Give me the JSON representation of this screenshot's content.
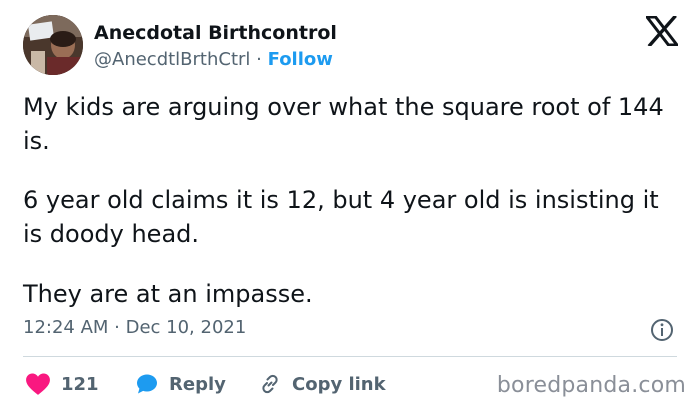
{
  "author": {
    "name": "Anecdotal Birthcontrol",
    "handle": "@AnecdtlBrthCtrl",
    "separator": "·",
    "follow_label": "Follow",
    "avatar_icon": "profile-photo"
  },
  "platform": {
    "logo_icon": "x-logo"
  },
  "tweet": {
    "paragraphs": [
      "My kids are arguing over what the square root of 144 is.",
      "6 year old claims it is 12, but 4 year old is insisting it is doody head.",
      "They are at an impasse."
    ],
    "timestamp": "12:24 AM · Dec 10, 2021"
  },
  "actions": {
    "like_count": "121",
    "reply_label": "Reply",
    "copy_label": "Copy link"
  },
  "watermark": "boredpanda.com",
  "colors": {
    "like": "#f91880",
    "reply": "#1d9bf0",
    "follow": "#1d9bf0",
    "secondary_text": "#536471"
  }
}
